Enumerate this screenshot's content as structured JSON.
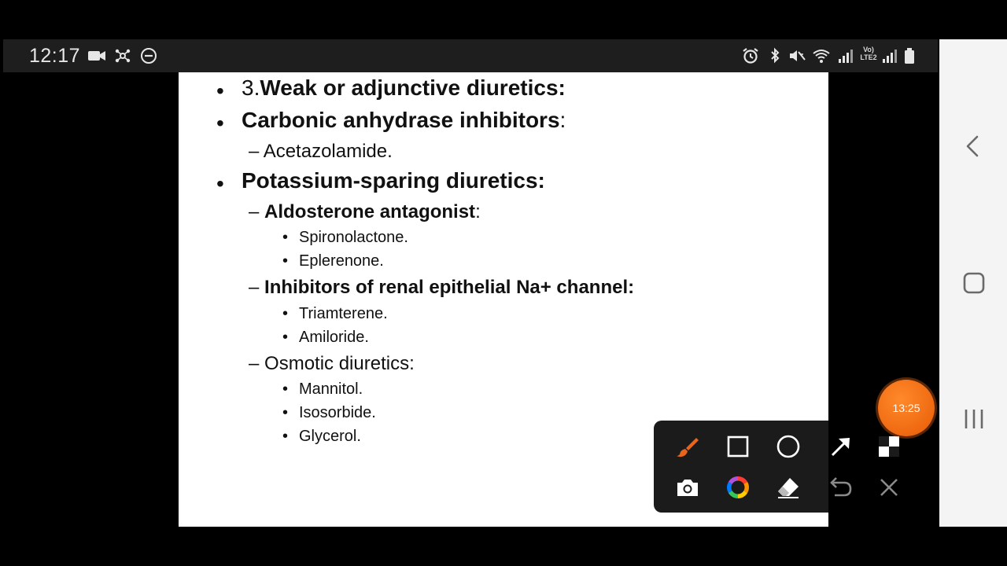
{
  "status_bar": {
    "time": "12:17",
    "network": "Vo) LTE2"
  },
  "slide": {
    "heading_prefix": "3.",
    "heading": "Weak or adjunctive diuretics:",
    "section1_title": "Carbonic anhydrase inhibitors",
    "section1_colon": ":",
    "section1_dash": "–",
    "section1_item": "Acetazolamide.",
    "section2_title": "Potassium-sparing diuretics:",
    "sub1_dash": "–",
    "sub1_title": "Aldosterone antagonist",
    "sub1_colon": ":",
    "sub1_items": [
      "Spironolactone.",
      "Eplerenone."
    ],
    "sub2_dash": "–",
    "sub2_title": "Inhibitors of renal epithelial Na+ channel:",
    "sub2_items": [
      "Triamterene.",
      "Amiloride."
    ],
    "sub3_dash": "–",
    "sub3_title": "Osmotic diuretics:",
    "sub3_items": [
      "Mannitol.",
      "Isosorbide.",
      "Glycerol."
    ],
    "bullet": "•"
  },
  "recorder": {
    "timer": "13:25"
  },
  "toolbar": {
    "tools": [
      "brush-icon",
      "rectangle-icon",
      "circle-icon",
      "arrow-icon",
      "mosaic-icon",
      "camera-icon",
      "color-wheel-icon",
      "eraser-icon",
      "undo-icon",
      "close-icon"
    ],
    "accent": "#e8651e"
  },
  "nav_bar": {
    "buttons": [
      "back-icon",
      "home-icon",
      "recents-icon"
    ]
  }
}
